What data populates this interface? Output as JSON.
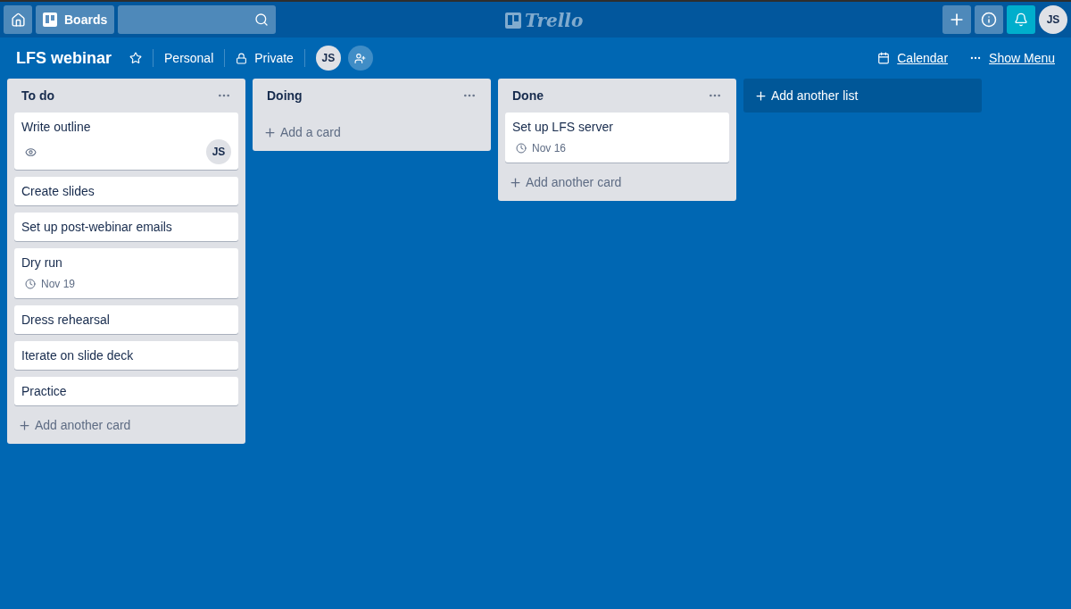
{
  "topbar": {
    "boards_label": "Boards",
    "logo": "Trello",
    "avatar": "JS"
  },
  "board": {
    "title": "LFS webinar",
    "starred": false,
    "team": "Personal",
    "visibility": "Private",
    "members": [
      "JS"
    ],
    "calendar": "Calendar",
    "menu": "Show Menu"
  },
  "lists": [
    {
      "name": "To do",
      "add_label": "Add another card",
      "cards": [
        {
          "title": "Write outline",
          "watching": true,
          "members": [
            "JS"
          ]
        },
        {
          "title": "Create slides"
        },
        {
          "title": "Set up post-webinar emails"
        },
        {
          "title": "Dry run",
          "due": "Nov 19"
        },
        {
          "title": "Dress rehearsal"
        },
        {
          "title": "Iterate on slide deck"
        },
        {
          "title": "Practice"
        }
      ]
    },
    {
      "name": "Doing",
      "add_label": "Add a card"
    },
    {
      "name": "Done",
      "add_label": "Add another card",
      "cards": [
        {
          "title": "Set up LFS server",
          "due": "Nov 16"
        }
      ]
    }
  ],
  "add_list": "Add another list"
}
